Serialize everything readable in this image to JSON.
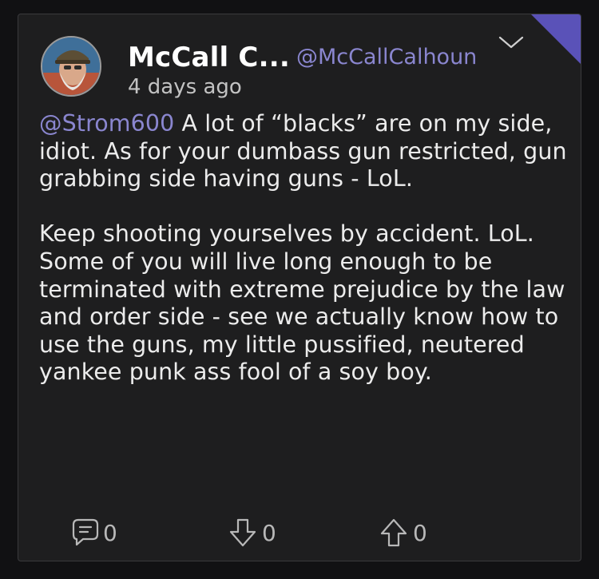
{
  "post": {
    "author": {
      "display_name": "McCall C...",
      "handle": "@McCallCalhoun"
    },
    "timestamp": "4 days ago",
    "mention": "@Strom600",
    "paragraph1": " A lot of “blacks” are on my side, idiot. As for your dumbass gun restricted, gun grabbing side having guns - LoL.",
    "paragraph2": "Keep shooting yourselves by accident. LoL. Some of you will live long enough to be terminated with extreme prejudice by the law and order side - see we actually know how to use the guns, my little pussified, neutered yankee punk ass fool of a soy boy."
  },
  "actions": {
    "comments_count": "0",
    "downvotes_count": "0",
    "upvotes_count": "0"
  },
  "icons": {
    "options": "chevron-down-icon",
    "comment": "comment-bubble-icon",
    "downvote": "arrow-down-icon",
    "upvote": "arrow-up-icon"
  },
  "colors": {
    "card_background": "#1e1e1f",
    "accent": "#8a86cf",
    "corner_ribbon": "#5a52b8",
    "text": "#ececec"
  }
}
